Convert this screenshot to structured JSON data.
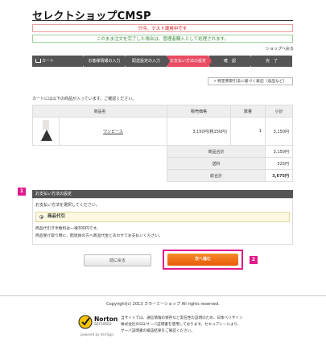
{
  "header": {
    "title": "セレクトショップCMSP"
  },
  "alerts": {
    "test_mode": "只今、テスト運用中です",
    "warning": "このまま注文を完了した場合は、管理者購入として処理されます。"
  },
  "nav": {
    "back_to_shop": "ショップへ戻る"
  },
  "steps": [
    {
      "label": "カート"
    },
    {
      "label": "お客様情報の入力"
    },
    {
      "label": "配送設定の入力"
    },
    {
      "label": "お支払い方法の設定"
    },
    {
      "label": "確　認"
    },
    {
      "label": "完　了"
    }
  ],
  "active_step_index": 3,
  "legal_link": "» 特定商取引法に基づく表記（返品など）",
  "cart": {
    "intro": "カートには以下の商品が入っています。ご確認ください。",
    "headers": {
      "product": "商品名",
      "price": "販売価格",
      "qty": "数量",
      "subtotal": "小計"
    },
    "items": [
      {
        "name": "ワンピース",
        "price": "3,150円(税150円)",
        "qty": "1",
        "subtotal": "3,150円"
      }
    ],
    "totals": [
      {
        "label": "商品合計",
        "value": "3,150円"
      },
      {
        "label": "送料",
        "value": "525円"
      },
      {
        "label": "総合計",
        "value": "3,675円"
      }
    ]
  },
  "payment": {
    "badge": "1",
    "heading": "お支払い方法の設定",
    "prompt": "お支払い方法を選択してください。",
    "option": "商品代引",
    "desc1": "商品代引き手数料は一律300円です。",
    "desc2": "商品受け取り時に、配達員の方へ商品代金とあわせてお支払いください。"
  },
  "buttons": {
    "back": "前に戻る",
    "next": "次へ進む",
    "badge": "2"
  },
  "footer": {
    "copyright": "Copyright(c) 2013 カラーミーショップ All rights reserved.",
    "norton_brand": "Norton",
    "norton_secured": "SECURED",
    "norton_powered": "powered by VeriSign",
    "ssl_lines": [
      "当サイトでは、通信情報の保存など実在性の証明のため、日本ベリサイン",
      "株式会社のSSLサーバ証明書を使用しております。セキュアシールより、",
      "サーバ証明書の検証結果をご確認ください。"
    ]
  },
  "colors": {
    "accent": "#e94b62",
    "highlight": "#e31a8c",
    "next_button": "#f07020"
  }
}
